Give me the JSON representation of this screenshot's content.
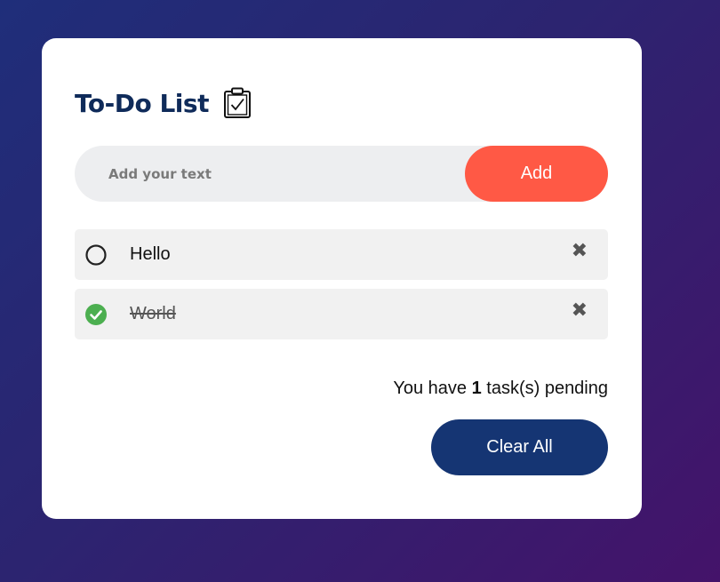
{
  "header": {
    "title": "To-Do List",
    "icon": "clipboard-check-icon"
  },
  "input": {
    "placeholder": "Add your text",
    "value": "",
    "add_label": "Add"
  },
  "tasks": [
    {
      "text": "Hello",
      "done": false,
      "delete_symbol": "✖"
    },
    {
      "text": "World",
      "done": true,
      "delete_symbol": "✖"
    }
  ],
  "footer": {
    "pending_prefix": "You have ",
    "pending_count": "1",
    "pending_suffix": " task(s) pending",
    "clear_label": "Clear All"
  },
  "colors": {
    "title": "#0f2b5a",
    "add_button": "#ff5945",
    "clear_button": "#153573",
    "checked": "#4caf50"
  }
}
